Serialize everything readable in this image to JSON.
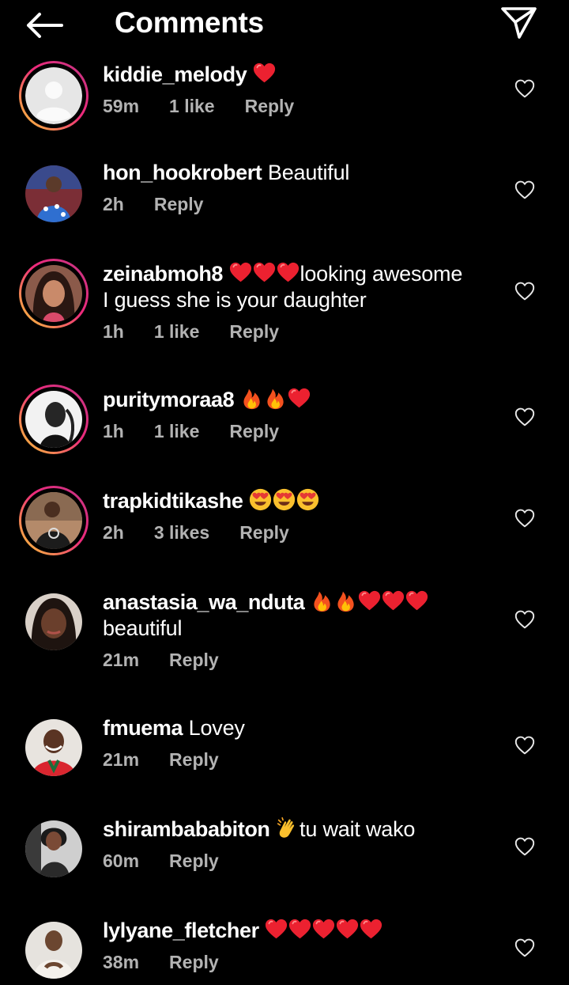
{
  "header": {
    "title": "Comments",
    "back_icon": "arrow-left-icon",
    "send_icon": "paper-plane-icon"
  },
  "comments": [
    {
      "user": "kiddie_melody",
      "text": "",
      "emoji_before": [
        "red-heart"
      ],
      "time": "59m",
      "likes": "1 like",
      "reply": "Reply",
      "avatar": "default-avatar"
    },
    {
      "user": "hon_hookrobert",
      "text": "Beautiful",
      "emoji_before": [],
      "time": "2h",
      "likes": "",
      "reply": "Reply",
      "avatar": "photo"
    },
    {
      "user": "zeinabmoh8",
      "text": "looking awesome",
      "text2": "I guess she is your daughter",
      "emoji_before": [
        "red-heart",
        "red-heart",
        "red-heart"
      ],
      "time": "1h",
      "likes": "1 like",
      "reply": "Reply",
      "avatar": "photo"
    },
    {
      "user": "puritymoraa8",
      "text": "",
      "emoji_before": [
        "fire",
        "fire",
        "red-heart"
      ],
      "time": "1h",
      "likes": "1 like",
      "reply": "Reply",
      "avatar": "photo"
    },
    {
      "user": "trapkidtikashe",
      "text": "",
      "emoji_before": [
        "heart-eyes",
        "heart-eyes",
        "heart-eyes"
      ],
      "time": "2h",
      "likes": "3 likes",
      "reply": "Reply",
      "avatar": "photo"
    },
    {
      "user": "anastasia_wa_nduta",
      "text": "",
      "text2": "beautiful",
      "emoji_before": [
        "fire",
        "fire",
        "red-heart",
        "red-heart",
        "red-heart"
      ],
      "time": "21m",
      "likes": "",
      "reply": "Reply",
      "avatar": "photo"
    },
    {
      "user": "fmuema",
      "text": "Lovey",
      "emoji_before": [],
      "time": "21m",
      "likes": "",
      "reply": "Reply",
      "avatar": "photo"
    },
    {
      "user": "shirambababiton",
      "text": "tu wait wako",
      "emoji_before": [
        "clapping-hands"
      ],
      "time": "60m",
      "likes": "",
      "reply": "Reply",
      "avatar": "photo"
    },
    {
      "user": "lylyane_fletcher",
      "text": "",
      "emoji_before": [
        "red-heart",
        "red-heart",
        "red-heart",
        "red-heart",
        "red-heart"
      ],
      "time": "38m",
      "likes": "",
      "reply": "Reply",
      "avatar": "photo"
    }
  ],
  "colors": {
    "background": "#000000",
    "meta_text": "#b3b3b3",
    "heart": "#e8222b",
    "story_ring": "#ee2a7b"
  }
}
